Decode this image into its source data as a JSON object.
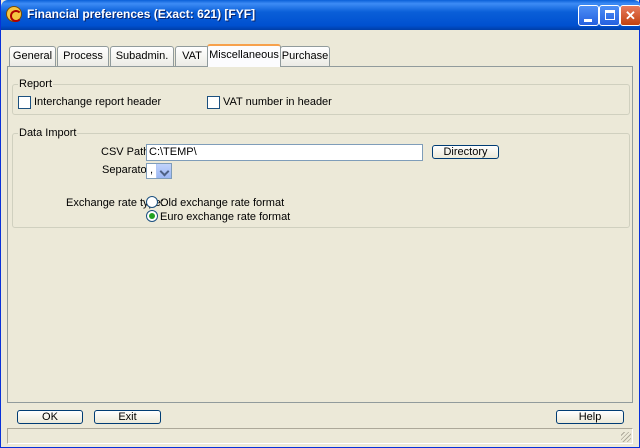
{
  "window": {
    "title": "Financial preferences (Exact: 621) [FYF]"
  },
  "tabs": [
    {
      "label": "General"
    },
    {
      "label": "Process"
    },
    {
      "label": "Subadmin."
    },
    {
      "label": "VAT"
    },
    {
      "label": "Miscellaneous",
      "active": true
    },
    {
      "label": "Purchase"
    }
  ],
  "report": {
    "legend": "Report",
    "interchange_header_label": "Interchange report header",
    "interchange_header_checked": false,
    "vat_number_label": "VAT number in header",
    "vat_number_checked": false
  },
  "data_import": {
    "legend": "Data Import",
    "csv_path_label": "CSV Path:",
    "csv_path_value": "C:\\TEMP\\",
    "directory_button": "Directory",
    "separator_label": "Separator:",
    "separator_value": ",",
    "exchange_rate_label": "Exchange rate type:",
    "exchange_options": [
      {
        "label": "Old exchange rate format",
        "selected": false
      },
      {
        "label": "Euro exchange rate format",
        "selected": true
      }
    ]
  },
  "buttons": {
    "ok": "OK",
    "exit": "Exit",
    "help": "Help"
  },
  "colors": {
    "titlebar": "#0a5fd8",
    "face": "#ece9d8",
    "active_tab_accent": "#f7a14c",
    "radio_dot": "#21a121"
  }
}
